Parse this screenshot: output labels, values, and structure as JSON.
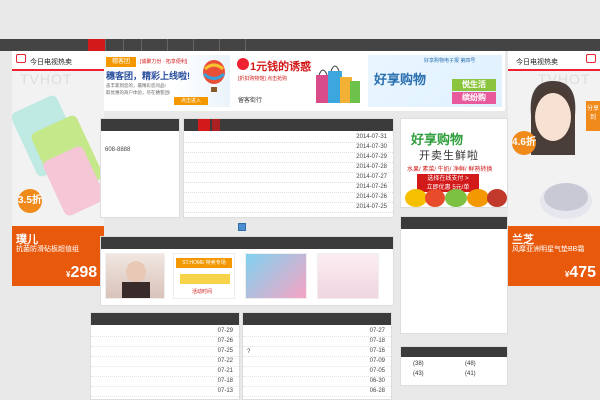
{
  "side_left": {
    "header": "今日电视热卖",
    "watermark": "TVHOT",
    "discount": "3.5折",
    "product_name": "璞儿",
    "product_desc": "抗菌防滑砧板超值组",
    "price_symbol": "¥",
    "price": "298"
  },
  "side_right": {
    "header": "今日电视热卖",
    "watermark": "TVHOT",
    "discount": "4.6折",
    "tag": "分享到",
    "product_name": "兰芝",
    "product_desc": "风靡亚洲明星气垫BB霜",
    "price_symbol": "¥",
    "price": "475"
  },
  "banners": {
    "ad1_brand": "穗客团",
    "ad1_title": "穗客团，精彩上线啦!",
    "ad1_sub": "[诚聚力份 · 拓享便利]",
    "ad1_text1": "盖丰家到您的，最精彩您问品!",
    "ad1_text2": "取优惠的商户体验，尽在穗客团!",
    "ad1_cta": "点击进入",
    "ad2_title": "1元钱的诱惑",
    "ad2_sub": "[折扣购物馆] 点击抢购",
    "ad2_brand": "留客街行",
    "ad3_title": "好享购物",
    "ad3_head": "好享购物电子报 第四号",
    "ad3_badge1": "悦生活",
    "ad3_badge2": "缤纷购"
  },
  "phone_card": {
    "phone": "608-8888"
  },
  "news_card": {
    "dates": [
      "2014-07-31",
      "2014-07-30",
      "2014-07-29",
      "2014-07-28",
      "2014-07-27",
      "2014-07-26",
      "2014-07-26",
      "2014-07-25"
    ]
  },
  "promo": {
    "title": "好享购物",
    "subtitle": "开卖生鲜啦",
    "slogan": "水果/ 素菜/ 牛奶/ 净鲜/ 鲜熟转换",
    "cta_line1": "选择在线支付 >",
    "cta_line2": "立即优惠 5元/单"
  },
  "products": {
    "thumb2_text": "ST.HOME 特卖专场",
    "thumb2_sub": "活动时间"
  },
  "list_left": {
    "dates": [
      "07-29",
      "07-26",
      "07-25",
      "07-22",
      "07-21",
      "07-18",
      "07-13"
    ]
  },
  "list_mid": {
    "mark": "?",
    "dates": [
      "07-27",
      "07-18",
      "07-16",
      "07-09",
      "07-05",
      "06-30",
      "06-28"
    ]
  },
  "counts": {
    "row1": [
      "(38)",
      "(48)"
    ],
    "row2": [
      "(43)",
      "(41)"
    ]
  },
  "colors": {
    "accent_red": "#d21a1a",
    "dark_bar": "#3b3b3b",
    "orange": "#e8590c",
    "green": "#2f9e3c"
  }
}
